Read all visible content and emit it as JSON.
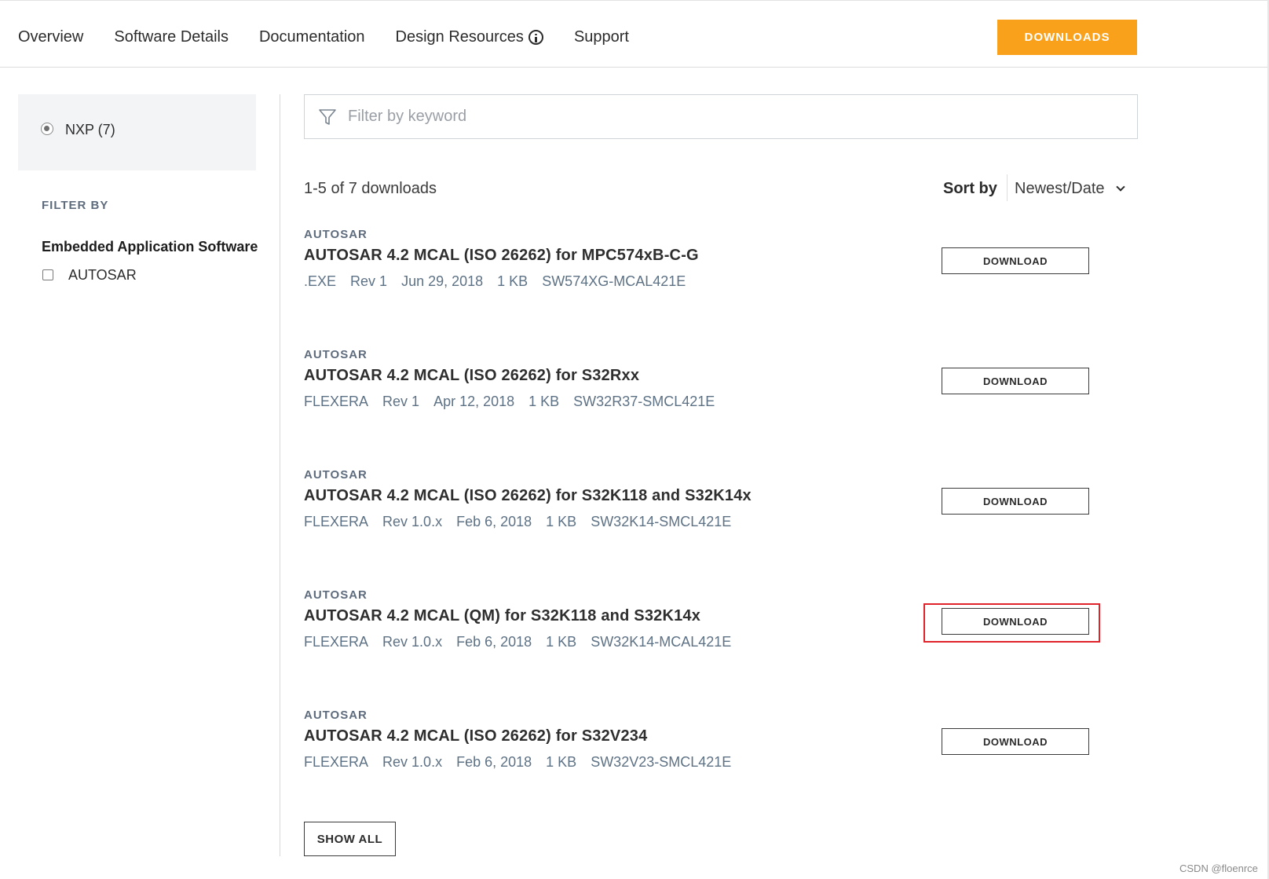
{
  "nav": {
    "items": [
      "Overview",
      "Software Details",
      "Documentation",
      "Design Resources",
      "Support"
    ],
    "downloads_button": "DOWNLOADS"
  },
  "sidebar": {
    "vendor_label": "NXP (7)",
    "filter_by": "FILTER BY",
    "filter_group": "Embedded Application Software",
    "filter_option": "AUTOSAR"
  },
  "search": {
    "placeholder": "Filter by keyword",
    "value": ""
  },
  "results": {
    "count": "1-5 of 7 downloads",
    "sort_label": "Sort by",
    "sort_value": "Newest/Date"
  },
  "items": [
    {
      "category": "AUTOSAR",
      "title": "AUTOSAR 4.2 MCAL (ISO 26262) for MPC574xB-C-G",
      "type": ".EXE",
      "rev": "Rev 1",
      "date": "Jun 29, 2018",
      "size": "1 KB",
      "id": "SW574XG-MCAL421E",
      "button": "DOWNLOAD"
    },
    {
      "category": "AUTOSAR",
      "title": "AUTOSAR 4.2 MCAL (ISO 26262) for S32Rxx",
      "type": "FLEXERA",
      "rev": "Rev 1",
      "date": "Apr 12, 2018",
      "size": "1 KB",
      "id": "SW32R37-SMCL421E",
      "button": "DOWNLOAD"
    },
    {
      "category": "AUTOSAR",
      "title": "AUTOSAR 4.2 MCAL (ISO 26262) for S32K118 and S32K14x",
      "type": "FLEXERA",
      "rev": "Rev 1.0.x",
      "date": "Feb 6, 2018",
      "size": "1 KB",
      "id": "SW32K14-SMCL421E",
      "button": "DOWNLOAD"
    },
    {
      "category": "AUTOSAR",
      "title": "AUTOSAR 4.2 MCAL (QM) for S32K118 and S32K14x",
      "type": "FLEXERA",
      "rev": "Rev 1.0.x",
      "date": "Feb 6, 2018",
      "size": "1 KB",
      "id": "SW32K14-MCAL421E",
      "button": "DOWNLOAD"
    },
    {
      "category": "AUTOSAR",
      "title": "AUTOSAR 4.2 MCAL (ISO 26262) for S32V234",
      "type": "FLEXERA",
      "rev": "Rev 1.0.x",
      "date": "Feb 6, 2018",
      "size": "1 KB",
      "id": "SW32V23-SMCL421E",
      "button": "DOWNLOAD"
    }
  ],
  "show_all": "SHOW ALL",
  "watermark": "CSDN @floenrce",
  "colors": {
    "accent": "#f9a11b",
    "highlight": "#e0222a",
    "meta_text": "#5e7286"
  }
}
